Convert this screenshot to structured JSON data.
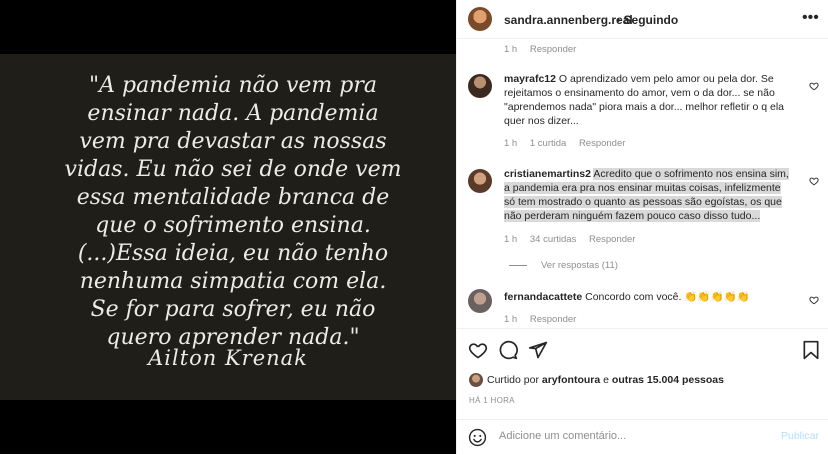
{
  "post": {
    "quote_lines": [
      "\"A pandemia não vem pra",
      "ensinar nada. A pandemia",
      "vem pra devastar as nossas",
      "vidas. Eu não sei de onde vem",
      "essa mentalidade branca de",
      "que o sofrimento ensina.",
      "(...)Essa ideia, eu não tenho",
      "nenhuma simpatia com ela.",
      "Se for para sofrer, eu não",
      "quero aprender nada.\""
    ],
    "author": "Ailton  Krenak"
  },
  "header": {
    "username": "sandra.annenberg.real",
    "follow_state": "• Seguindo",
    "more_icon": "more-horizontal-icon"
  },
  "top_meta": {
    "time": "1 h",
    "reply": "Responder"
  },
  "comments": [
    {
      "username": "mayrafc12",
      "text": "O aprendizado vem pelo amor ou pela dor. Se rejeitamos o ensinamento do amor, vem o da dor... se não \"aprendemos nada\" piora mais a dor... melhor refletir o q ela quer nos dizer...",
      "time": "1 h",
      "likes": "1 curtida",
      "reply": "Responder"
    },
    {
      "username": "cristianemartins2",
      "text": "Acredito que o sofrimento nos ensina sim, a pandemia era pra nos ensinar muitas coisas, infelizmente só tem mostrado o quanto as pessoas são egoístas, os que não perderam ninguém fazem pouco caso disso tudo...",
      "time": "1 h",
      "likes": "34 curtidas",
      "reply": "Responder",
      "view_replies": "Ver respostas (11)"
    },
    {
      "username": "fernandacattete",
      "text": "Concordo com você. 👏👏👏👏👏",
      "time": "1 h",
      "reply": "Responder"
    }
  ],
  "actions": {
    "liked_by_prefix": "Curtido por",
    "liked_by_user": "aryfontoura",
    "liked_by_mid": "e",
    "liked_by_others": "outras 15.004 pessoas",
    "timestamp": "HÁ 1 HORA"
  },
  "composer": {
    "placeholder": "Adicione um comentário...",
    "post_label": "Publicar"
  },
  "colors": {
    "accent_disabled": "#b2dffc",
    "muted": "#8e8e8e",
    "quote_bg": "#201e19"
  }
}
